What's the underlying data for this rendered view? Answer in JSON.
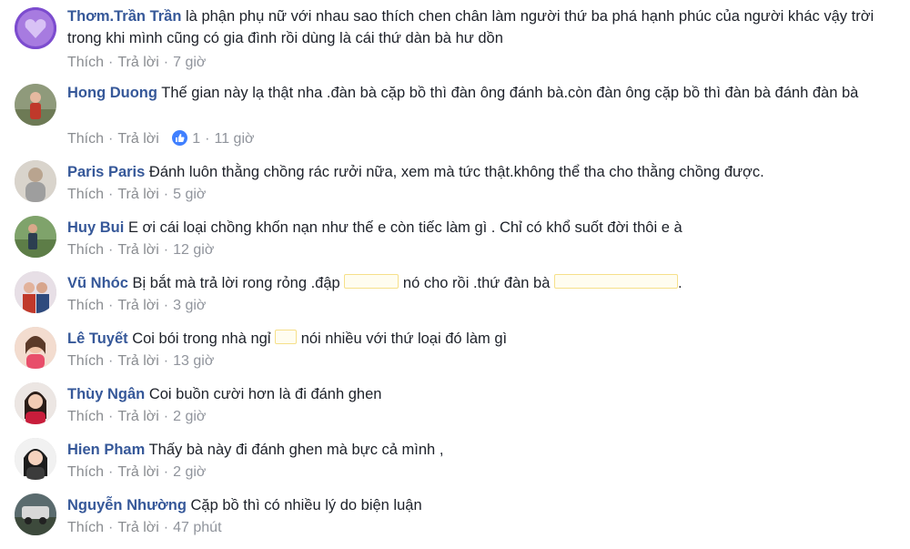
{
  "comments": [
    {
      "author": "Thơm.Trần Trần",
      "text": "là phận phụ nữ với nhau sao thích chen chân làm người thứ ba phá hạnh phúc của người khác vậy trời trong khi mình cũng có gia đình rồi dùng là cái thứ dàn bà hư dồn",
      "like": "Thích",
      "reply": "Trả lời",
      "time": "7 giờ"
    },
    {
      "author": "Hong Duong",
      "text": "Thế gian này lạ thật nha .đàn bà cặp bồ thì đàn ông đánh bà.còn đàn ông cặp bồ thì đàn bà đánh đàn bà",
      "like": "Thích",
      "reply": "Trả lời",
      "reactions": "1",
      "time": "11 giờ"
    },
    {
      "author": "Paris Paris",
      "text": "Đánh luôn thằng chồng rác rưởi nữa, xem mà tức thật.không thể tha cho thằng chồng được.",
      "like": "Thích",
      "reply": "Trả lời",
      "time": "5 giờ"
    },
    {
      "author": "Huy Bui",
      "text": "E ơi cái loại chồng khốn nạn như thế e còn tiếc làm gì . Chỉ có khổ suốt đời thôi e à",
      "like": "Thích",
      "reply": "Trả lời",
      "time": "12 giờ"
    },
    {
      "author": "Vũ Nhóc",
      "text_a": "Bị bắt mà trả lời rong rỏng .đập",
      "text_b": "nó cho rồi .thứ đàn bà",
      "text_c": ".",
      "like": "Thích",
      "reply": "Trả lời",
      "time": "3 giờ"
    },
    {
      "author": "Lê Tuyết",
      "text_a": "Coi bói trong nhà ngỉ",
      "text_b": "nói nhiều với thứ loại đó làm gì",
      "like": "Thích",
      "reply": "Trả lời",
      "time": "13 giờ"
    },
    {
      "author": "Thùy Ngân",
      "text": "Coi buồn cười hơn là đi đánh ghen",
      "like": "Thích",
      "reply": "Trả lời",
      "time": "2 giờ"
    },
    {
      "author": "Hien Pham",
      "text": "Thấy bà này đi đánh ghen mà bực cả mình ,",
      "like": "Thích",
      "reply": "Trả lời",
      "time": "2 giờ"
    },
    {
      "author": "Nguyễn Nhường",
      "text": "Cặp bồ thì có nhiều lý do biện luận",
      "like": "Thích",
      "reply": "Trả lời",
      "time": "47 phút"
    }
  ],
  "separator": "·",
  "colors": {
    "author": "#365899",
    "text": "#1d2129",
    "meta": "#90949c",
    "like_badge": "#4080ff"
  }
}
